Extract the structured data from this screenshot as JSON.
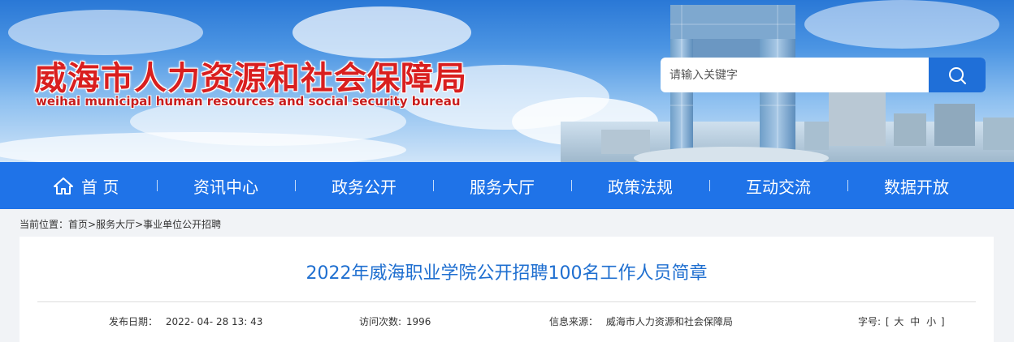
{
  "header": {
    "title": "威海市人力资源和社会保障局",
    "subtitle": "weihai municipal human resources and social security bureau"
  },
  "search": {
    "placeholder": "请输入关键字",
    "icon": "search-icon"
  },
  "nav": {
    "home_icon": "home-icon",
    "items": [
      "首 页",
      "资讯中心",
      "政务公开",
      "服务大厅",
      "政策法规",
      "互动交流",
      "数据开放"
    ]
  },
  "breadcrumb": {
    "label": "当前位置：",
    "items": [
      "首页",
      "服务大厅",
      "事业单位公开招聘"
    ],
    "separator": ">"
  },
  "article": {
    "title": "2022年威海职业学院公开招聘100名工作人员简章",
    "publish_label": "发布日期：",
    "publish_date": "2022- 04- 28 13: 43",
    "visits_label": "访问次数:",
    "visits": "1996",
    "source_label": "信息来源：",
    "source": "威海市人力资源和社会保障局",
    "fontsize_label": "字号:",
    "fontsize_open": "[",
    "fontsize_options": [
      "大",
      "中",
      "小"
    ],
    "fontsize_close": "]"
  },
  "colors": {
    "title_red": "#d91f1f",
    "nav_blue": "#1f73e8",
    "article_title_blue": "#1f6fd0"
  }
}
